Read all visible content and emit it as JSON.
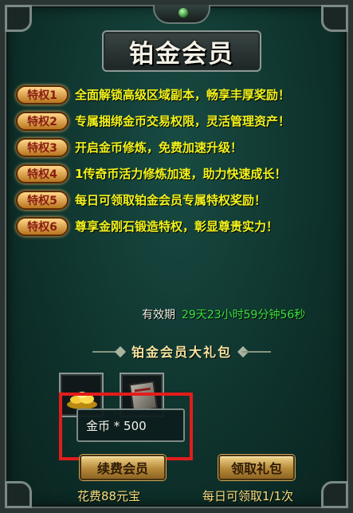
{
  "title": "铂金会员",
  "privileges": [
    {
      "badge": "特权1",
      "text": "全面解锁高级区域副本，畅享丰厚奖励！"
    },
    {
      "badge": "特权2",
      "text": "专属捆绑金币交易权限，灵活管理资产！"
    },
    {
      "badge": "特权3",
      "text": "开启金币修炼，免费加速升级！"
    },
    {
      "badge": "特权4",
      "text": "1传奇币活力修炼加速，助力快速成长！"
    },
    {
      "badge": "特权5",
      "text": "每日可领取铂金会员专属特权奖励！"
    },
    {
      "badge": "特权6",
      "text": "尊享金刚石锻造特权，彰显尊贵实力！"
    }
  ],
  "validity": {
    "label": "有效期",
    "value": "29天23小时59分钟56秒"
  },
  "gift": {
    "title": "铂金会员大礼包",
    "items": [
      {
        "icon": "gold-coins-icon"
      },
      {
        "icon": "book-icon"
      }
    ],
    "tooltip": "金币 * 500"
  },
  "buttons": {
    "renew": "续费会员",
    "claim": "领取礼包"
  },
  "footer": {
    "cost": "花费88元宝",
    "limit": "每日可领取1/1次"
  },
  "colors": {
    "privilege_text": "#f2f31c",
    "validity_value": "#39e33b",
    "highlight": "#e31c1c"
  }
}
